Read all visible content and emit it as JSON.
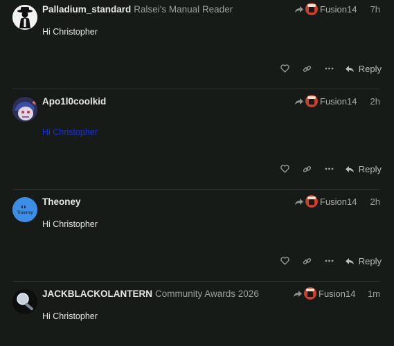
{
  "posts": [
    {
      "username": "Palladium_standard",
      "user_title": "Ralsei's Manual Reader",
      "reply_to": "Fusion14",
      "time": "7h",
      "content": "Hi Christopher",
      "content_is_link": false,
      "avatar_colors": {
        "bg": "#f2f2f2",
        "figure": "#111111"
      }
    },
    {
      "username": "Apo1l0coolkid",
      "user_title": "",
      "reply_to": "Fusion14",
      "time": "2h",
      "content": "Hi Christopher",
      "content_is_link": true,
      "avatar_colors": {
        "bg": "#2d2f56",
        "figure": "#e0d7e6"
      }
    },
    {
      "username": "Theoney",
      "user_title": "",
      "reply_to": "Fusion14",
      "time": "2h",
      "content": "Hi Christopher",
      "content_is_link": false,
      "avatar_text": "Theoney",
      "avatar_colors": {
        "bg": "#3d8ee6",
        "figure": "#0b1e3a"
      }
    },
    {
      "username": "JACKBLACKOLANTERN",
      "user_title": "Community Awards 2026",
      "reply_to": "Fusion14",
      "time": "1m",
      "content": "Hi Christopher",
      "content_is_link": false,
      "avatar_colors": {
        "bg": "#0d0f0e",
        "figure": "#c9d2dc"
      }
    }
  ],
  "actions": {
    "reply_label": "Reply",
    "icons": [
      "heart-icon",
      "link-icon",
      "more-icon",
      "reply-icon"
    ]
  },
  "colors": {
    "background": "#161b18",
    "divider": "#2f3531",
    "link": "#1a2fd6"
  }
}
